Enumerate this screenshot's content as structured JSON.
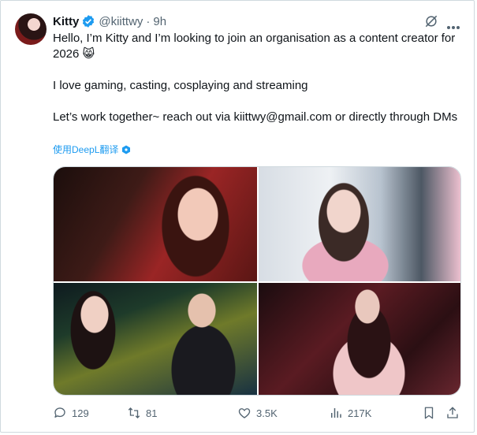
{
  "author": {
    "name": "Kitty",
    "handle": "@kiittwy",
    "separator": "·",
    "time": "9h"
  },
  "tweet": {
    "lines": [
      "Hello, I’m Kitty and I’m looking to join an organisation as a content creator for 2026 😸",
      "I love gaming, casting, cosplaying and streaming",
      "Let’s work together~ reach out via kiittwy@gmail.com or directly through DMs"
    ],
    "translate_link": "使用DeepL翻译"
  },
  "actions": {
    "replies": "129",
    "reposts": "81",
    "likes": "3.5K",
    "views": "217K"
  },
  "colors": {
    "accent": "#1d9bf0",
    "muted": "#536471",
    "text": "#0f1419",
    "border": "#cfd9de"
  },
  "icons": [
    "verified-badge-icon",
    "grok-icon",
    "more-icon",
    "deepl-icon",
    "reply-icon",
    "repost-icon",
    "like-icon",
    "views-icon",
    "bookmark-icon",
    "share-icon"
  ]
}
